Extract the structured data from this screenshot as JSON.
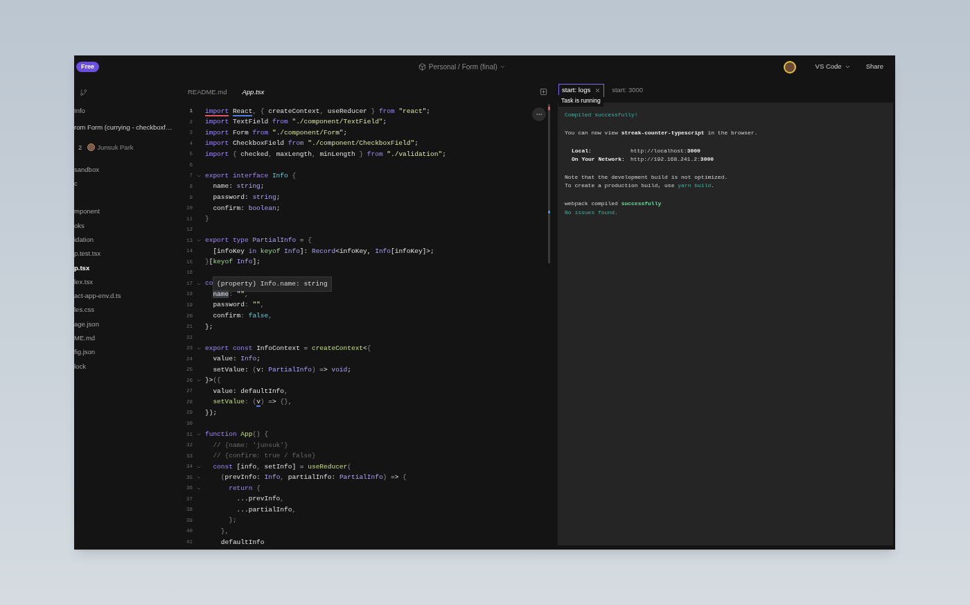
{
  "header": {
    "plan_badge": "Free",
    "breadcrumb": "Personal / Form (final)",
    "editor_button": "VS Code",
    "share_button": "Share"
  },
  "sidebar": {
    "header_items": [
      "Info",
      "rom Form (currying - checkboxf…"
    ],
    "commit": {
      "count": "2",
      "author": "Junsuk Park"
    },
    "file_groups": [
      {
        "files": [
          {
            "name": "sandbox",
            "selected": false
          },
          {
            "name": "c",
            "selected": false
          }
        ]
      },
      {
        "files": [
          {
            "name": "mponent",
            "selected": false
          },
          {
            "name": "oks",
            "selected": false
          },
          {
            "name": "idation",
            "selected": false
          },
          {
            "name": "p.test.tsx",
            "selected": false
          },
          {
            "name": "p.tsx",
            "selected": true
          },
          {
            "name": "lex.tsx",
            "selected": false
          },
          {
            "name": "act-app-env.d.ts",
            "selected": false
          },
          {
            "name": "les.css",
            "selected": false
          },
          {
            "name": "age.json",
            "selected": false
          },
          {
            "name": "ME.md",
            "selected": false
          },
          {
            "name": "fig.json",
            "selected": false
          },
          {
            "name": "lock",
            "selected": false
          }
        ]
      }
    ]
  },
  "editor": {
    "tabs": [
      {
        "label": "README.md",
        "selected": false
      },
      {
        "label": "App.tsx",
        "selected": true
      }
    ],
    "lines": [
      {
        "number": "1",
        "fold": false,
        "tokens": [
          {
            "text": "import ",
            "kind": "kwerr"
          },
          {
            "text": "React",
            "kind": "idinfo"
          },
          {
            "text": ", { ",
            "kind": "pu"
          },
          {
            "text": "createContext",
            "kind": "id"
          },
          {
            "text": ", ",
            "kind": "pu"
          },
          {
            "text": "useReducer",
            "kind": "id"
          },
          {
            "text": " } ",
            "kind": "pu"
          },
          {
            "text": "from ",
            "kind": "kw"
          },
          {
            "text": "\"react\"",
            "kind": "str"
          },
          {
            "text": ";",
            "kind": "id"
          }
        ]
      },
      {
        "number": "2",
        "fold": false,
        "tokens": [
          {
            "text": "import",
            "kind": "kw"
          },
          {
            "text": " TextField ",
            "kind": "id"
          },
          {
            "text": "from ",
            "kind": "kw"
          },
          {
            "text": "\"./component/TextField\"",
            "kind": "str"
          },
          {
            "text": ";",
            "kind": "id"
          }
        ]
      },
      {
        "number": "3",
        "fold": false,
        "tokens": [
          {
            "text": "import",
            "kind": "kw"
          },
          {
            "text": " Form ",
            "kind": "id"
          },
          {
            "text": "from ",
            "kind": "kw"
          },
          {
            "text": "\"./component/Form\"",
            "kind": "str"
          },
          {
            "text": ";",
            "kind": "id"
          }
        ]
      },
      {
        "number": "4",
        "fold": false,
        "tokens": [
          {
            "text": "import",
            "kind": "kw"
          },
          {
            "text": " CheckboxField ",
            "kind": "id"
          },
          {
            "text": "from ",
            "kind": "kw"
          },
          {
            "text": "\"./component/CheckboxField\"",
            "kind": "str"
          },
          {
            "text": ";",
            "kind": "id"
          }
        ]
      },
      {
        "number": "5",
        "fold": false,
        "tokens": [
          {
            "text": "import",
            "kind": "kw"
          },
          {
            "text": " { ",
            "kind": "pu"
          },
          {
            "text": "checked",
            "kind": "id"
          },
          {
            "text": ", ",
            "kind": "pu"
          },
          {
            "text": "maxLength",
            "kind": "id"
          },
          {
            "text": ", ",
            "kind": "pu"
          },
          {
            "text": "minLength",
            "kind": "id"
          },
          {
            "text": " } ",
            "kind": "pu"
          },
          {
            "text": "from ",
            "kind": "kw"
          },
          {
            "text": "\"./validation\"",
            "kind": "str"
          },
          {
            "text": ";",
            "kind": "id"
          }
        ]
      },
      {
        "number": "6",
        "fold": false
      },
      {
        "number": "7",
        "fold": true,
        "tokens": [
          {
            "text": "export interface ",
            "kind": "kw"
          },
          {
            "text": "Info",
            "kind": "lit"
          },
          {
            "text": " {",
            "kind": "pu"
          }
        ]
      },
      {
        "number": "8",
        "fold": false,
        "tokens": [
          {
            "text": "  name: ",
            "kind": "id"
          },
          {
            "text": "string",
            "kind": "ty"
          },
          {
            "text": ";",
            "kind": "id"
          }
        ]
      },
      {
        "number": "9",
        "fold": false,
        "tokens": [
          {
            "text": "  password: ",
            "kind": "id"
          },
          {
            "text": "string",
            "kind": "ty"
          },
          {
            "text": ";",
            "kind": "id"
          }
        ]
      },
      {
        "number": "10",
        "fold": false,
        "tokens": [
          {
            "text": "  confirm: ",
            "kind": "id"
          },
          {
            "text": "boolean",
            "kind": "ty"
          },
          {
            "text": ";",
            "kind": "id"
          }
        ]
      },
      {
        "number": "11",
        "fold": false,
        "tokens": [
          {
            "text": "}",
            "kind": "pu"
          }
        ]
      },
      {
        "number": "12",
        "fold": false
      },
      {
        "number": "13",
        "fold": true,
        "tokens": [
          {
            "text": "export type ",
            "kind": "kw"
          },
          {
            "text": "PartialInfo",
            "kind": "ty"
          },
          {
            "text": " = ",
            "kind": "id"
          },
          {
            "text": "{",
            "kind": "pu"
          }
        ]
      },
      {
        "number": "14",
        "fold": false,
        "tokens": [
          {
            "text": "  [infoKey ",
            "kind": "id"
          },
          {
            "text": "in ",
            "kind": "kw"
          },
          {
            "text": "keyof ",
            "kind": "kof"
          },
          {
            "text": "Info",
            "kind": "ty"
          },
          {
            "text": "]: ",
            "kind": "id"
          },
          {
            "text": "Record",
            "kind": "ty"
          },
          {
            "text": "<infoKey, ",
            "kind": "id"
          },
          {
            "text": "Info",
            "kind": "ty"
          },
          {
            "text": "[infoKey]>;",
            "kind": "id"
          }
        ]
      },
      {
        "number": "15",
        "fold": false,
        "tokens": [
          {
            "text": "}",
            "kind": "pu"
          },
          {
            "text": "[",
            "kind": "id"
          },
          {
            "text": "keyof ",
            "kind": "kof"
          },
          {
            "text": "Info",
            "kind": "ty"
          },
          {
            "text": "];",
            "kind": "id"
          }
        ]
      },
      {
        "number": "16",
        "fold": false
      },
      {
        "number": "17",
        "fold": true,
        "tokens": [
          {
            "text": "co",
            "kind": "kw"
          }
        ],
        "tooltip": "(property) Info.name: string"
      },
      {
        "number": "18",
        "fold": false,
        "tokens": [
          {
            "text": "  name",
            "kind": "idhl"
          },
          {
            "text": ": ",
            "kind": "pu"
          },
          {
            "text": "\"\"",
            "kind": "str"
          },
          {
            "text": ",",
            "kind": "pu"
          }
        ]
      },
      {
        "number": "19",
        "fold": false,
        "tokens": [
          {
            "text": "  password",
            "kind": "id"
          },
          {
            "text": ": ",
            "kind": "pu"
          },
          {
            "text": "\"\"",
            "kind": "str"
          },
          {
            "text": ",",
            "kind": "pu"
          }
        ]
      },
      {
        "number": "20",
        "fold": false,
        "tokens": [
          {
            "text": "  confirm",
            "kind": "id"
          },
          {
            "text": ": ",
            "kind": "pu"
          },
          {
            "text": "false",
            "kind": "lit"
          },
          {
            "text": ",",
            "kind": "pu"
          }
        ]
      },
      {
        "number": "21",
        "fold": false,
        "tokens": [
          {
            "text": "};",
            "kind": "id"
          }
        ]
      },
      {
        "number": "22",
        "fold": false
      },
      {
        "number": "23",
        "fold": true,
        "tokens": [
          {
            "text": "export const ",
            "kind": "kw"
          },
          {
            "text": "InfoContext = ",
            "kind": "id"
          },
          {
            "text": "createContext",
            "kind": "fn"
          },
          {
            "text": "<",
            "kind": "id"
          },
          {
            "text": "{",
            "kind": "pu"
          }
        ]
      },
      {
        "number": "24",
        "fold": false,
        "tokens": [
          {
            "text": "  value: ",
            "kind": "id"
          },
          {
            "text": "Info",
            "kind": "ty"
          },
          {
            "text": ";",
            "kind": "id"
          }
        ]
      },
      {
        "number": "25",
        "fold": false,
        "tokens": [
          {
            "text": "  setValue: ",
            "kind": "id"
          },
          {
            "text": "(",
            "kind": "pu"
          },
          {
            "text": "v: ",
            "kind": "id"
          },
          {
            "text": "PartialInfo",
            "kind": "ty"
          },
          {
            "text": ") ",
            "kind": "pu"
          },
          {
            "text": "=> ",
            "kind": "id"
          },
          {
            "text": "void",
            "kind": "ty"
          },
          {
            "text": ";",
            "kind": "id"
          }
        ]
      },
      {
        "number": "26",
        "fold": true,
        "tokens": [
          {
            "text": "}>",
            "kind": "id"
          },
          {
            "text": "({",
            "kind": "pu"
          }
        ]
      },
      {
        "number": "27",
        "fold": false,
        "tokens": [
          {
            "text": "  value: defaultInfo",
            "kind": "id"
          },
          {
            "text": ",",
            "kind": "pu"
          }
        ]
      },
      {
        "number": "28",
        "fold": false,
        "tokens": [
          {
            "text": "  setValue",
            "kind": "fn"
          },
          {
            "text": ": (",
            "kind": "pu"
          },
          {
            "text": "v",
            "kind": "idinfo"
          },
          {
            "text": ") ",
            "kind": "pu"
          },
          {
            "text": "=> ",
            "kind": "id"
          },
          {
            "text": "{},",
            "kind": "pu"
          }
        ]
      },
      {
        "number": "29",
        "fold": false,
        "tokens": [
          {
            "text": "});",
            "kind": "id"
          }
        ]
      },
      {
        "number": "30",
        "fold": false
      },
      {
        "number": "31",
        "fold": true,
        "tokens": [
          {
            "text": "function ",
            "kind": "kw"
          },
          {
            "text": "App",
            "kind": "fn"
          },
          {
            "text": "() {",
            "kind": "pu"
          }
        ]
      },
      {
        "number": "32",
        "fold": false,
        "tokens": [
          {
            "text": "  // {name: 'junsuk'}",
            "kind": "cm"
          }
        ]
      },
      {
        "number": "33",
        "fold": false,
        "tokens": [
          {
            "text": "  // {confirm: true / false}",
            "kind": "cm"
          }
        ]
      },
      {
        "number": "34",
        "fold": true,
        "tokens": [
          {
            "text": "  const ",
            "kind": "kw"
          },
          {
            "text": "[info",
            "kind": "id"
          },
          {
            "text": ", ",
            "kind": "pu"
          },
          {
            "text": "setInfo] = ",
            "kind": "id"
          },
          {
            "text": "useReducer",
            "kind": "fn"
          },
          {
            "text": "(",
            "kind": "pu"
          }
        ]
      },
      {
        "number": "35",
        "fold": true,
        "tokens": [
          {
            "text": "    (",
            "kind": "pu"
          },
          {
            "text": "prevInfo: ",
            "kind": "id"
          },
          {
            "text": "Info",
            "kind": "ty"
          },
          {
            "text": ", ",
            "kind": "pu"
          },
          {
            "text": "partialInfo: ",
            "kind": "id"
          },
          {
            "text": "PartialInfo",
            "kind": "ty"
          },
          {
            "text": ") ",
            "kind": "pu"
          },
          {
            "text": "=> ",
            "kind": "id"
          },
          {
            "text": "{",
            "kind": "pu"
          }
        ]
      },
      {
        "number": "36",
        "fold": true,
        "tokens": [
          {
            "text": "      return ",
            "kind": "kw"
          },
          {
            "text": "{",
            "kind": "pu"
          }
        ]
      },
      {
        "number": "37",
        "fold": false,
        "tokens": [
          {
            "text": "        ...prevInfo",
            "kind": "id"
          },
          {
            "text": ",",
            "kind": "pu"
          }
        ]
      },
      {
        "number": "38",
        "fold": false,
        "tokens": [
          {
            "text": "        ...partialInfo",
            "kind": "id"
          },
          {
            "text": ",",
            "kind": "pu"
          }
        ]
      },
      {
        "number": "39",
        "fold": false,
        "tokens": [
          {
            "text": "      };",
            "kind": "pu"
          }
        ]
      },
      {
        "number": "40",
        "fold": false,
        "tokens": [
          {
            "text": "    },",
            "kind": "pu"
          }
        ]
      },
      {
        "number": "41",
        "fold": false,
        "tokens": [
          {
            "text": "    defaultInfo",
            "kind": "id"
          }
        ]
      }
    ]
  },
  "terminal": {
    "tabs": [
      {
        "label": "start: logs",
        "selected": true,
        "closable": true
      },
      {
        "label": "start: 3000",
        "selected": false,
        "closable": false
      }
    ],
    "status_tooltip": "Task is running",
    "blocks": [
      {
        "kind": "text",
        "lines": [
          {
            "tokens": [
              {
                "text": "Compiled successfully!",
                "kind": "accent"
              }
            ]
          }
        ]
      },
      {
        "kind": "text",
        "lines": [
          {
            "tokens": [
              {
                "text": "You can now view ",
                "kind": "plain"
              },
              {
                "text": "streak-counter-typescript",
                "kind": "bold"
              },
              {
                "text": " in the browser.",
                "kind": "plain"
              }
            ]
          }
        ]
      },
      {
        "kind": "table",
        "rows": [
          {
            "label": "Local:",
            "value": [
              {
                "text": "http://localhost:",
                "kind": "plain"
              },
              {
                "text": "3000",
                "kind": "bold"
              }
            ]
          },
          {
            "label": "On Your Network:",
            "value": [
              {
                "text": "http://192.168.241.2:",
                "kind": "plain"
              },
              {
                "text": "3000",
                "kind": "bold"
              }
            ]
          }
        ]
      },
      {
        "kind": "text",
        "lines": [
          {
            "tokens": [
              {
                "text": "Note that the development build is not optimized.",
                "kind": "plain"
              }
            ]
          },
          {
            "tokens": [
              {
                "text": "To create a production build, use ",
                "kind": "plain"
              },
              {
                "text": "yarn build",
                "kind": "accent"
              },
              {
                "text": ".",
                "kind": "plain"
              }
            ]
          }
        ]
      },
      {
        "kind": "text",
        "lines": [
          {
            "tokens": [
              {
                "text": "webpack compiled ",
                "kind": "plain"
              },
              {
                "text": "successfully",
                "kind": "success"
              }
            ]
          },
          {
            "tokens": [
              {
                "text": "No issues found.",
                "kind": "accent"
              }
            ]
          }
        ]
      }
    ]
  }
}
